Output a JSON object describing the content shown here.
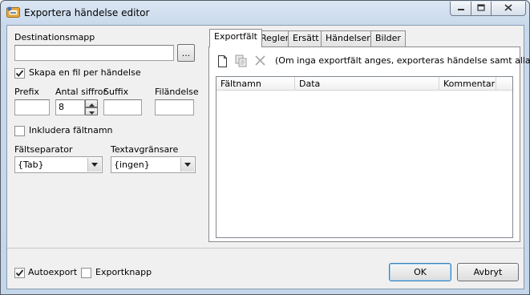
{
  "window": {
    "title": "Exportera händelse editor"
  },
  "left": {
    "destination_label": "Destinationsmapp",
    "destination_value": "",
    "browse_label": "...",
    "one_file_per_event_label": "Skapa en fil per händelse",
    "one_file_per_event_checked": true,
    "prefix_label": "Prefix",
    "prefix_value": "",
    "digits_label": "Antal siffror",
    "digits_value": "8",
    "suffix_label": "Suffix",
    "suffix_value": "",
    "extension_label": "Filändelse",
    "extension_value": "",
    "include_fieldnames_label": "Inkludera fältnamn",
    "include_fieldnames_checked": false,
    "field_separator_label": "Fältseparator",
    "field_separator_value": "{Tab}",
    "text_delimiter_label": "Textavgränsare",
    "text_delimiter_value": "{ingen}"
  },
  "tabs": [
    "Exportfält",
    "Regler",
    "Ersätt",
    "Händelser",
    "Bilder"
  ],
  "active_tab": "Exportfält",
  "exportfields": {
    "hint": "(Om inga exportfält anges, exporteras händelse samt alla fält)",
    "columns": [
      "Fältnamn",
      "Data",
      "Kommentar"
    ],
    "rows": []
  },
  "footer": {
    "autoexport_label": "Autoexport",
    "autoexport_checked": true,
    "exportbutton_label": "Exportknapp",
    "exportbutton_checked": false,
    "ok_label": "OK",
    "cancel_label": "Avbryt"
  },
  "colors": {
    "titlebar": "#c9d9ec",
    "dialog_bg": "#f0f0f0",
    "close_red": "#c75050"
  }
}
